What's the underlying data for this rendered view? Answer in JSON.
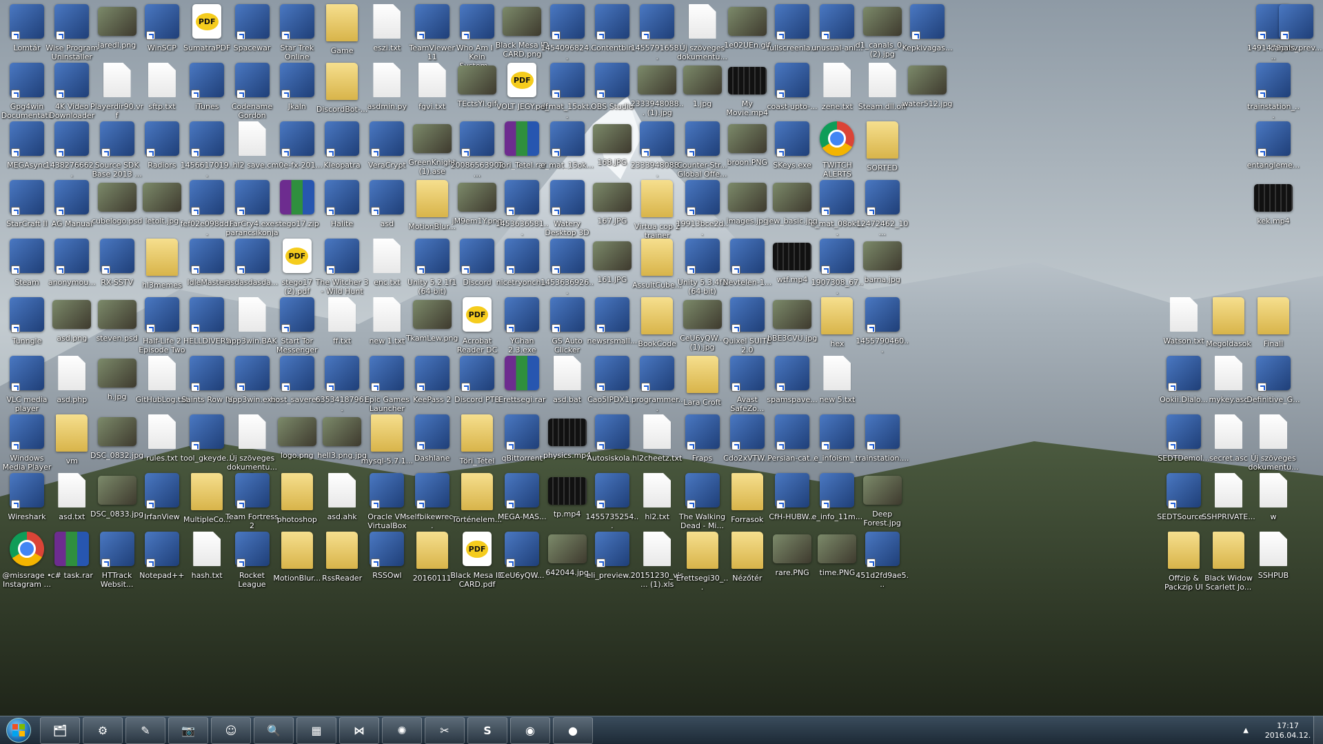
{
  "colors": {
    "taskbar_top": "#3a4c5c",
    "taskbar_bottom": "#1d2a36",
    "label_text": "#ffffff"
  },
  "desktop": {
    "columns": [
      [
        "Lomtár",
        "Gpg4win Documentati...",
        "MEGAsync",
        "StarCraft II",
        "Steam",
        "Tunngle",
        "VLC media player",
        "Windows Media Player",
        "Wireshark",
        "@missrage • Instagram ..."
      ],
      [
        "Wise Program Uninstaller",
        "4K Video Downloader",
        "1438276662...",
        "AG Manual",
        "anonymou...",
        "asd.png",
        "asd.php",
        "vm",
        "asd.txt",
        "c# task.rar"
      ],
      [
        "jaredl.png",
        "Playerdir90.vrf",
        "Source SDK Base 2013 ...",
        "cubelogo.psd",
        "RX-SSTV",
        "steven.psd",
        "h.jpg",
        "DSC_0832.jpg",
        "DSC_0833.jpg",
        "HTTrack Websit..."
      ],
      [
        "WinSCP",
        "sftp.txt",
        "Radiors",
        "letolt.jpg",
        "hl3memes",
        "Half-Life 2 Episode Two",
        "GitHubLog.txt",
        "rules.txt",
        "IrfanView",
        "Notepad++"
      ],
      [
        "SumatraPDF",
        "iTunes",
        "1456617019...",
        "fef02e098dd...",
        "IdleMaster",
        "HELLDIVERS",
        "Saints Row IV",
        "tool_gkeyde...",
        "MultipleCo...",
        "hash.txt"
      ],
      [
        "Spacewar",
        "Codename Gordon",
        "hl2 save.c",
        "FarCry4.exe parancsikonja",
        "asdasdasda...",
        "app3win.BAK",
        "app3win.exe",
        "Új szöveges dokumentu... 2",
        "Team Fortress 2",
        "Rocket League"
      ],
      [
        "Star Trek Online",
        "Jkaln",
        "m0e-fx-201...",
        "stego17.zip",
        "stego17 (2).pdf",
        "Start Tor Messenger",
        "host_savere...",
        "logo.png",
        "photoshop",
        "MotionBlur..."
      ],
      [
        "Game",
        "DiscordBot-...",
        "Kleopatra",
        "Halite",
        "The Witcher 3 - Wild Hunt",
        "ff.txt",
        "6353418796...",
        "hell3.png.jpg",
        "asd.ahk",
        "RssReader"
      ],
      [
        "eszi.txt",
        "asdmin.py",
        "VeraCrypt",
        "asd",
        "enc.txt",
        "new 1.txt",
        "Epic Games Launcher",
        "mysql-5.7.1...",
        "Oracle VM VirtualBox",
        "RSSOwl"
      ],
      [
        "TeamViewer 11",
        "fgvi.txt",
        "GreenKnight (1).ase",
        "MotionBlur...",
        "Unity 5.2.1f1 (64-bit)",
        "TkamLew.png",
        "KeePass 2",
        "Dashlane",
        "selfbikewrec...",
        "20160111"
      ],
      [
        "Who Am I - Kein System...",
        "TEctsYl.gif",
        "20086563902...",
        "jM9em1Y.png",
        "Discord",
        "Acrobat Reader DC",
        "Discord PTB",
        "Töri_Tétel",
        "Történelem...",
        "Black Mesa ID CARD.pdf"
      ],
      [
        "Black Mesa ID CARD.png",
        "VOLT JEGY.pdf",
        "Tori_Tetel.rar",
        "1453636581...",
        "nicetryonch...",
        "YChan 2.3.exe",
        "Erettsegi.rar",
        "qBittorrent",
        "MEGA-MAS...",
        "CeU6yQW..."
      ],
      [
        "1454096824...",
        "e_mat_15okt...",
        "e_mat_15ok...",
        "Watery Desktop 3D",
        "1453636926...",
        "GS Auto Clicker",
        "asd.bat",
        "physics.mp4",
        "tp.mp4",
        "642044.jpg"
      ],
      [
        "Contentbin",
        "OBS Studio",
        "168.JPG",
        "167.JPG",
        "161.JPG",
        "newsrsmall...",
        "Cao5IPDX1...",
        "Autosiskola...",
        "1455735254...",
        "eli_preview...."
      ],
      [
        "1455791658...",
        "2333948088... (1).jpg",
        "2333948088...",
        "Virtua cop 2 trainer",
        "AssultCube...",
        "BookCode",
        "programmer...",
        "hl2cheetz.txt",
        "hl2.txt",
        "20151230_vis... (1).xls"
      ],
      [
        "Új szöveges dokumentu...",
        "1.jpg",
        "Counter-Str... Global Offe...",
        "19913bce2d...",
        "Unity 5.3.4f1 (64-bit)",
        "CeU6yQW... (1).jpg",
        "Lara Croft",
        "Fraps",
        "The Walking Dead - Mi...",
        "Erettsegi30_..."
      ],
      [
        "1e02UEn.gif",
        "My Movie.mp4",
        "broon.PNG",
        "images.jpg",
        "Nevtelen-1...",
        "Quixel SUITE 2.0",
        "Avast SafeZo...",
        "Cdo2xVTW...",
        "Forrasok",
        "Nézőtér"
      ],
      [
        "fullscreenla...",
        "coast-upto-...",
        "SKeys.exe",
        "jew_basic.jpg",
        "wtf.mp4",
        "bBE3CVU.jpg",
        "spamspave...",
        "Persian-cat...",
        "CfH-HUBW...",
        "rare.PNG"
      ],
      [
        "unusual-ani...",
        "zene.txt",
        "TWITCH ALERTS",
        "e_mat_08okt...",
        "1907308_67...",
        "hex",
        "new 5.txt",
        "e_infoism_...",
        "e_info_11m...",
        "time.PNG"
      ],
      [
        "d1_canals_0... (2).jpg",
        "Steam.dll.off",
        "SORTED",
        "12472462_10...",
        "barna.jpg",
        "1455790460...",
        "",
        "trainstation....",
        "Deep Forest.jpg",
        "451d2fd9ae5..."
      ],
      [
        "Kepkivagas...",
        "water512.jpg"
      ]
    ],
    "right_columns": [
      [
        "",
        "",
        "",
        "",
        "",
        "Watson.txt",
        "Ookii.Dialo...",
        "SEDTDemol...",
        "SEDTSource...",
        "Offzip & Packzip UI"
      ],
      [
        "",
        "",
        "",
        "",
        "",
        "Megoldasok",
        "mykey.asc",
        "secret.asc",
        "SSHPRIVATE...",
        "Black Widow Scarlett Jo..."
      ],
      [
        "1491473prev...",
        "trainstation_...",
        "entangleme...",
        "kek.mp4",
        "",
        "Finall",
        "Definitive_G...",
        "Új szöveges dokumentu...",
        "w",
        "SSHPUB"
      ],
      [
        "canals_prev...",
        "",
        "",
        "",
        "",
        "",
        "",
        "",
        "",
        ""
      ]
    ]
  },
  "icon_kinds": {
    "Lomtár": "trash-icon",
    "Steam": "steam-icon",
    "MEGAsync": "mega-icon",
    "VLC media player": "vlc-icon",
    "Wireshark": "wireshark-icon",
    "@missrage • Instagram ...": "chrome",
    "TWITCH ALERTS": "chrome",
    "Discord": "discord-icon",
    "Discord PTB": "discord-icon"
  },
  "taskbar": {
    "items": [
      {
        "name": "explorer",
        "glyph": "🗂"
      },
      {
        "name": "steam",
        "glyph": "⚙"
      },
      {
        "name": "notepad",
        "glyph": "✎"
      },
      {
        "name": "camera",
        "glyph": "📷"
      },
      {
        "name": "messenger",
        "glyph": "☺"
      },
      {
        "name": "search",
        "glyph": "🔍"
      },
      {
        "name": "calculator",
        "glyph": "▦"
      },
      {
        "name": "visual-studio",
        "glyph": "⋈"
      },
      {
        "name": "settings",
        "glyph": "✺"
      },
      {
        "name": "paint",
        "glyph": "✂"
      },
      {
        "name": "skype",
        "glyph": "S"
      },
      {
        "name": "discord",
        "glyph": "◉"
      },
      {
        "name": "chrome",
        "glyph": "●"
      }
    ],
    "clock_time": "17:17",
    "clock_date": "2016.04.12.",
    "tray_arrow": "▲"
  }
}
